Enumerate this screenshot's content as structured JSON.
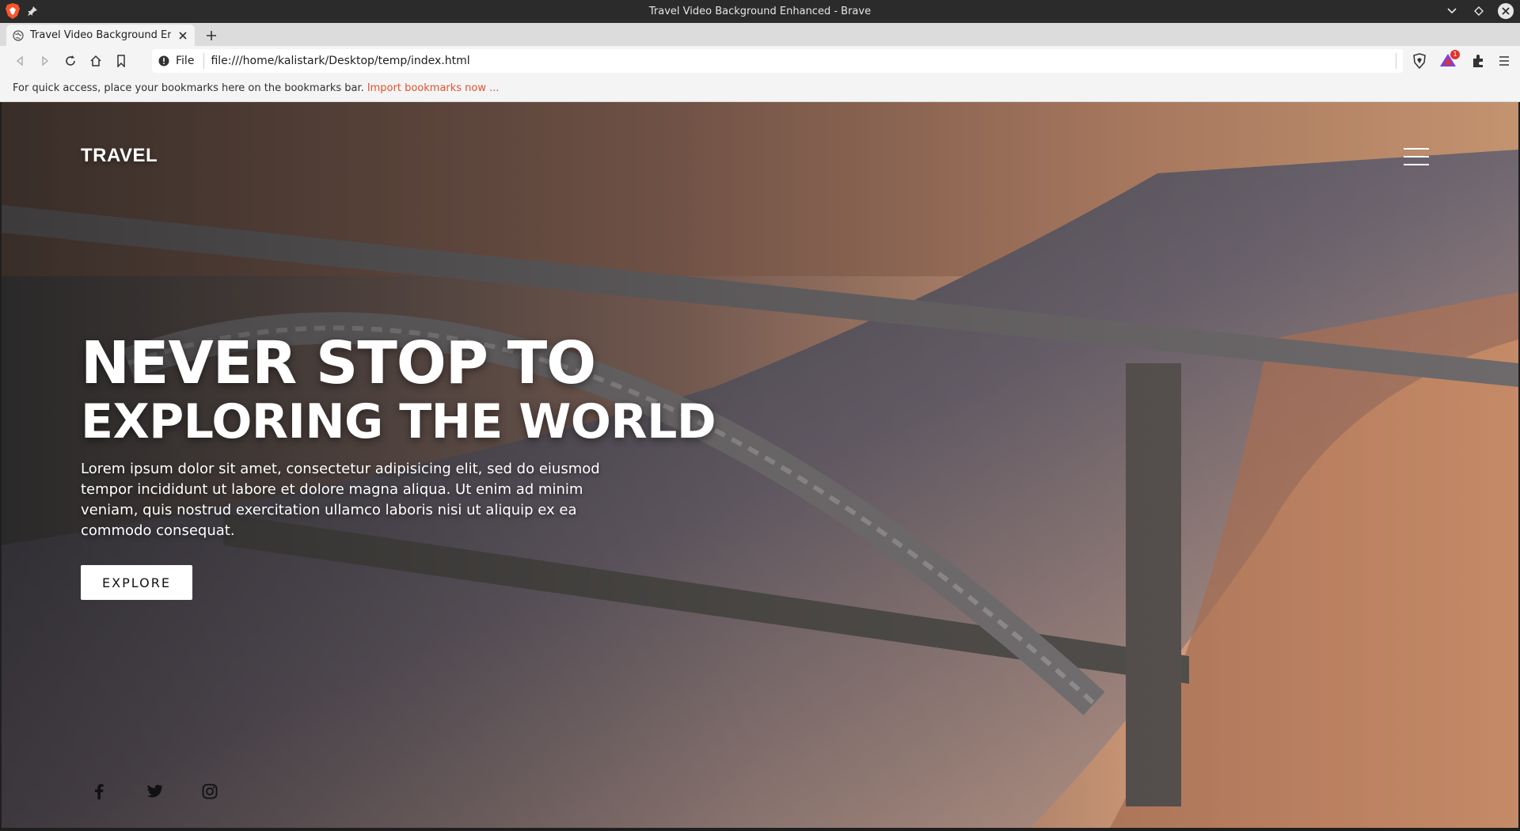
{
  "window": {
    "title": "Travel Video Background Enhanced - Brave"
  },
  "tabs": [
    {
      "label": "Travel Video Background En",
      "active": true
    }
  ],
  "toolbar": {
    "site_info_label": "File",
    "url": "file:///home/kalistark/Desktop/temp/index.html",
    "rewards_count": "1"
  },
  "bookmarks_bar": {
    "message": "For quick access, place your bookmarks here on the bookmarks bar.",
    "import_link": "Import bookmarks now ..."
  },
  "page": {
    "logo": "TRAVEL",
    "hero_line1": "NEVER STOP TO",
    "hero_line2": "EXPLORING THE WORLD",
    "description": "Lorem ipsum dolor sit amet, consectetur adipisicing elit, sed do eiusmod tempor incididunt ut labore et dolore magna aliqua. Ut enim ad minim veniam, quis nostrud exercitation ullamco laboris nisi ut aliquip ex ea commodo consequat.",
    "cta_label": "EXPLORE",
    "social_icons": [
      "facebook-icon",
      "twitter-icon",
      "instagram-icon"
    ]
  },
  "colors": {
    "accent_link": "#e0532f",
    "badge": "#e0342b",
    "text_on_hero": "#ffffff"
  }
}
